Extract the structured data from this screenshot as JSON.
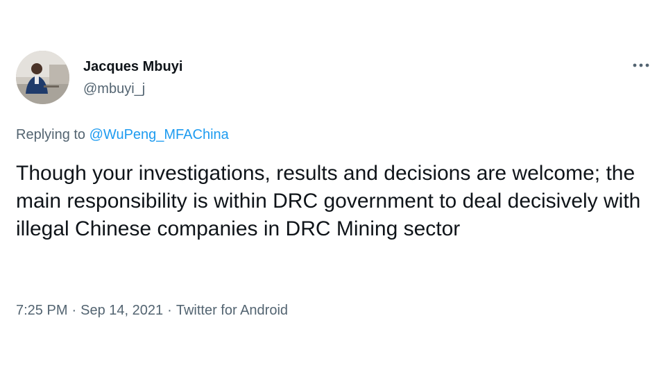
{
  "author": {
    "display_name": "Jacques Mbuyi",
    "handle": "@mbuyi_j"
  },
  "reply": {
    "prefix": "Replying to",
    "mention": "@WuPeng_MFAChina"
  },
  "tweet": {
    "text": "Though your investigations, results and decisions are welcome; the main responsibility is within DRC government to deal decisively with illegal Chinese companies in DRC Mining sector"
  },
  "meta": {
    "time": "7:25 PM",
    "separator": "·",
    "date": "Sep 14, 2021",
    "source": "Twitter for Android"
  },
  "icons": {
    "more": "more-options-icon"
  },
  "colors": {
    "text_primary": "#0f1419",
    "text_secondary": "#536471",
    "link": "#1d9bf0"
  }
}
